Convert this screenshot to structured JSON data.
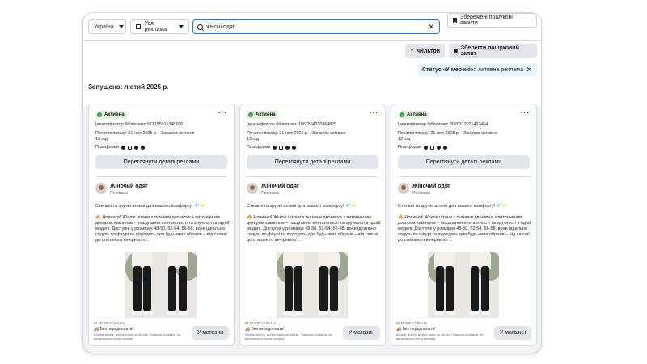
{
  "filters": {
    "country": "Україна",
    "ad_category": "Уся реклама",
    "search_value": "жіночі одяг",
    "saved_searches_label": "Збережені пошукові запити",
    "filters_label": "Фільтри",
    "save_search_label": "Зберегти пошуковий запит",
    "status_chip_key": "Статус «У мережі»:",
    "status_chip_value": "Активна реклама"
  },
  "launched_label": "Запущено: лютий 2025 р.",
  "cards": [
    {
      "status": "Активна",
      "library_id": "Ідентифікатор бібліотеки: 577155915348166",
      "start_line": "Початок показу: 21 лют 2025 р. · Загалом активне",
      "duration": "13 год",
      "platforms_label": "Платформи",
      "details_button": "Переглянути деталі реклами",
      "page_name": "Жіночий одяг",
      "page_type": "Реклама",
      "headline_text": "Стильні та зручні штани для вашого комфорту! 💎✨",
      "body_text": "🔥 Новинка! Жіночі штани з тканини двонитка з витонченим декором камінням – поєднання елегантності та зручності в одній моделі. Доступні у розмірах 48-50, 52-54, 56-58, вони ідеально сядуть по фігурі та підходять для будь-яких образів – від casual до стильного вечірнього ...",
      "site": "IB.MODE.COM.UA",
      "free_shipping": "🚚 Без передоплати!",
      "free_sub": "Штани зручні, добре сідає по фігуру. Тканина приємна, не вигинається після носіння",
      "cta": "У магазин"
    },
    {
      "status": "Активна",
      "library_id": "Ідентифікатор бібліотеки: 1667564330864879",
      "start_line": "Початок показу: 21 лют 2025 р. · Загалом активне",
      "duration": "13 год",
      "platforms_label": "Платформи",
      "details_button": "Переглянути деталі реклами",
      "page_name": "Жіночий одяг",
      "page_type": "Реклама",
      "headline_text": "Стильні та зручні штани для вашого комфорту! 💎✨",
      "body_text": "🔥 Новинка! Жіночі штани з тканини двонитка з витонченим декором камінням – поєднання елегантності та зручності в одній моделі. Доступні у розмірах 48-50, 52-54, 56-58, вони ідеально сядуть по фігурі та підходять для будь-яких образів – від casual до стильного вечірнього ...",
      "site": "IB.MODE.COM.UA",
      "free_shipping": "🚚 Без передоплати!",
      "free_sub": "Штани зручні, добре сідає по фігуру. Тканина приємна, не вигинається після носіння",
      "cta": "У магазин"
    },
    {
      "status": "Активна",
      "library_id": "Ідентифікатор бібліотеки: 3020312071462454",
      "start_line": "Початок показу: 21 лют 2025 р. · Загалом активне",
      "duration": "13 год",
      "platforms_label": "Платформи",
      "details_button": "Переглянути деталі реклами",
      "page_name": "Жіночий одяг",
      "page_type": "Реклама",
      "headline_text": "Стильні та зручні штани для вашого комфорту! 💎✨",
      "body_text": "🔥 Новинка! Жіночі штани з тканини двонитка з витонченим декором камінням – поєднання елегантності та зручності в одній моделі. Доступні у розмірах 48-50, 52-54, 56-58, вони ідеально сядуть по фігурі та підходять для будь-яких образів – від casual до стильного вечірнього ...",
      "site": "IB.MODE.COM.UA",
      "free_shipping": "🚚 Без передоплати!",
      "free_sub": "Штани зручні, добре сідає по фігуру. Тканина приємна, не вигинається після носіння",
      "cta": "У магазин"
    }
  ],
  "colors": {
    "accent": "#1877f2",
    "active_green": "#31a24c",
    "chip_bg": "#e7f3ff"
  },
  "icons": [
    "tv-icon",
    "search-icon",
    "close-icon",
    "bookmark-icon",
    "filter-icon",
    "facebook-icon",
    "instagram-icon",
    "messenger-icon",
    "audience-network-icon"
  ]
}
